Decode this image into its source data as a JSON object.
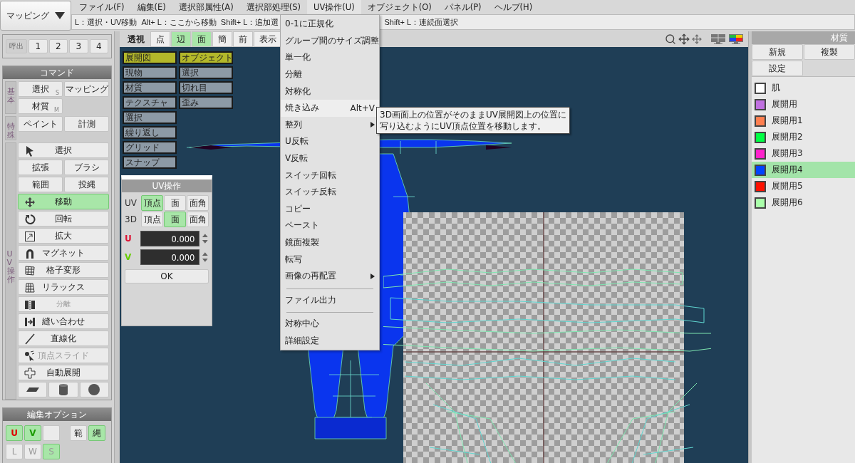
{
  "mode_selector": {
    "label": "マッピング"
  },
  "menu_bar": [
    {
      "label": "ファイル(F)",
      "selected": false
    },
    {
      "label": "編集(E)",
      "selected": false
    },
    {
      "label": "選択部属性(A)",
      "selected": false
    },
    {
      "label": "選択部処理(S)",
      "selected": false
    },
    {
      "label": "UV操作(U)",
      "selected": true
    },
    {
      "label": "オブジェクト(O)",
      "selected": false
    },
    {
      "label": "パネル(P)",
      "selected": false
    },
    {
      "label": "ヘルプ(H)",
      "selected": false
    }
  ],
  "status_hints": {
    "left": [
      "L：選択・UV移動",
      "Alt+ L：ここから移動",
      "Shift+ L：追加選"
    ],
    "right": [
      "Shift+ L：連続面選択"
    ]
  },
  "presets": {
    "label": "呼出",
    "slots": [
      "1",
      "2",
      "3",
      "4"
    ]
  },
  "command_panel": {
    "title": "コマンド",
    "groups": [
      {
        "label": "基本",
        "buttons": [
          {
            "label": "選択",
            "key": "S",
            "selected": false
          },
          {
            "label": "マッピング",
            "selected": false
          },
          {
            "label": "材質",
            "key": "M",
            "selected": false
          }
        ]
      },
      {
        "label": "特殊",
        "buttons": [
          {
            "label": "ペイント",
            "selected": false
          },
          {
            "label": "計測",
            "selected": false
          }
        ]
      }
    ],
    "uv_group": {
      "label": "UV操作",
      "rows": [
        [
          {
            "label": "選択",
            "kind": "pointer",
            "selected": false,
            "disabled": false
          }
        ],
        [
          {
            "label": "拡張",
            "kind": "text",
            "selected": false,
            "disabled": false
          },
          {
            "label": "ブラシ",
            "kind": "text",
            "selected": false,
            "disabled": false
          }
        ],
        [
          {
            "label": "範囲",
            "kind": "text",
            "selected": false,
            "disabled": false
          },
          {
            "label": "投縄",
            "kind": "text",
            "selected": false,
            "disabled": false
          }
        ],
        [
          {
            "label": "移動",
            "kind": "move",
            "selected": true,
            "disabled": false
          }
        ],
        [
          {
            "label": "回転",
            "kind": "rotate",
            "selected": false,
            "disabled": false
          }
        ],
        [
          {
            "label": "拡大",
            "kind": "scale",
            "selected": false,
            "disabled": false
          }
        ],
        [
          {
            "label": "マグネット",
            "kind": "magnet",
            "selected": false,
            "disabled": false
          }
        ],
        [
          {
            "label": "格子変形",
            "kind": "lattice",
            "selected": false,
            "disabled": false
          }
        ],
        [
          {
            "label": "リラックス",
            "kind": "relax",
            "selected": false,
            "disabled": false
          }
        ],
        [
          {
            "label": "分離",
            "kind": "split",
            "selected": false,
            "disabled": true
          }
        ],
        [
          {
            "label": "縫い合わせ",
            "kind": "stitch",
            "selected": false,
            "disabled": false
          }
        ],
        [
          {
            "label": "直線化",
            "kind": "line",
            "selected": false,
            "disabled": false
          }
        ],
        [
          {
            "label": "頂点スライド",
            "kind": "slide",
            "selected": false,
            "disabled": true
          }
        ],
        [
          {
            "label": "自動展開",
            "kind": "unfold",
            "selected": false,
            "disabled": false
          }
        ],
        [
          {
            "kind": "plane",
            "selected": false
          },
          {
            "kind": "cylinder",
            "selected": false
          },
          {
            "kind": "sphere",
            "selected": false
          }
        ]
      ]
    }
  },
  "edit_options": {
    "title": "編集オプション",
    "rows": [
      [
        {
          "label": "U",
          "color": "#e00000",
          "on": true
        },
        {
          "label": "V",
          "color": "#1a9a00",
          "on": true
        },
        {
          "kind": "blank",
          "on": false
        },
        {
          "kind": "gap"
        },
        {
          "label": "範",
          "on": false
        },
        {
          "label": "縄",
          "on": true
        }
      ],
      [
        {
          "label": "L",
          "on": false,
          "disabled": true
        },
        {
          "label": "W",
          "on": false,
          "disabled": true
        },
        {
          "label": "S",
          "on": true,
          "disabled": true
        }
      ]
    ]
  },
  "view_toolbar": [
    {
      "label": "透視",
      "kind": "label"
    },
    {
      "label": "点",
      "selected": false
    },
    {
      "label": "辺",
      "selected": true
    },
    {
      "label": "面",
      "selected": true
    },
    {
      "label": "簡",
      "selected": false
    },
    {
      "label": "前",
      "selected": false
    },
    {
      "label": "表示",
      "selected": false
    }
  ],
  "display_toggles": {
    "left": [
      {
        "label": "展開図",
        "on": true
      },
      {
        "label": "現物",
        "on": false
      },
      {
        "label": "材質",
        "on": false
      },
      {
        "label": "テクスチャ",
        "on": false
      },
      {
        "label": "選択",
        "on": false
      },
      {
        "label": "繰り返し",
        "on": false
      },
      {
        "label": "グリッド",
        "on": false
      },
      {
        "label": "スナップ",
        "on": false
      }
    ],
    "right": [
      {
        "label": "オブジェクト",
        "on": true
      },
      {
        "label": "選択",
        "on": false
      },
      {
        "label": "切れ目",
        "on": false
      },
      {
        "label": "歪み",
        "on": false
      }
    ]
  },
  "uv_dialog": {
    "title": "UV操作",
    "rows": [
      {
        "label": "UV",
        "options": [
          {
            "label": "頂点",
            "selected": true
          },
          {
            "label": "面",
            "selected": false
          },
          {
            "label": "面角",
            "selected": false
          }
        ]
      },
      {
        "label": "3D",
        "options": [
          {
            "label": "頂点",
            "selected": false
          },
          {
            "label": "面",
            "selected": true
          },
          {
            "label": "面角",
            "selected": false
          }
        ]
      }
    ],
    "fields": [
      {
        "label": "U",
        "color": "#dd1133",
        "value": "0.000"
      },
      {
        "label": "V",
        "color": "#66cc00",
        "value": "0.000"
      }
    ],
    "ok": "OK"
  },
  "uv_menu": [
    {
      "kind": "item",
      "label": "0-1に正規化",
      "selected": false,
      "submenu": false
    },
    {
      "kind": "item",
      "label": "グループ間のサイズ調整",
      "selected": false,
      "submenu": false
    },
    {
      "kind": "item",
      "label": "単一化",
      "selected": false,
      "submenu": false
    },
    {
      "kind": "item",
      "label": "分離",
      "selected": false,
      "submenu": false
    },
    {
      "kind": "item",
      "label": "対称化",
      "selected": false,
      "submenu": false
    },
    {
      "kind": "item",
      "label": "焼き込み",
      "shortcut": "Alt+V",
      "selected": true,
      "submenu": false
    },
    {
      "kind": "item",
      "label": "整列",
      "selected": false,
      "submenu": true
    },
    {
      "kind": "item",
      "label": "U反転",
      "selected": false,
      "submenu": false
    },
    {
      "kind": "item",
      "label": "V反転",
      "selected": false,
      "submenu": false
    },
    {
      "kind": "item",
      "label": "スイッチ回転",
      "selected": false,
      "submenu": false
    },
    {
      "kind": "item",
      "label": "スイッチ反転",
      "selected": false,
      "submenu": false
    },
    {
      "kind": "item",
      "label": "コピー",
      "selected": false,
      "submenu": false
    },
    {
      "kind": "item",
      "label": "ペースト",
      "selected": false,
      "submenu": false
    },
    {
      "kind": "item",
      "label": "鏡面複製",
      "selected": false,
      "submenu": false
    },
    {
      "kind": "item",
      "label": "転写",
      "selected": false,
      "submenu": false
    },
    {
      "kind": "item",
      "label": "画像の再配置",
      "selected": false,
      "submenu": true
    },
    {
      "kind": "separator"
    },
    {
      "kind": "item",
      "label": "ファイル出力",
      "selected": false,
      "submenu": false
    },
    {
      "kind": "separator"
    },
    {
      "kind": "item",
      "label": "対称中心",
      "selected": false,
      "submenu": false
    },
    {
      "kind": "item",
      "label": "詳細設定",
      "selected": false,
      "submenu": false
    }
  ],
  "tooltip": {
    "lines": [
      "3D画面上の位置がそのままUV展開図上の位置に",
      "写り込むようにUV頂点位置を移動します。"
    ]
  },
  "materials": {
    "title": "材質",
    "buttons": [
      "新規",
      "複製",
      "設定"
    ],
    "items": [
      {
        "name": "肌",
        "color": "#ffffff",
        "selected": false
      },
      {
        "name": "展開用",
        "color": "#c070e0",
        "selected": false
      },
      {
        "name": "展開用1",
        "color": "#ff7f50",
        "selected": false
      },
      {
        "name": "展開用2",
        "color": "#00ff44",
        "selected": false
      },
      {
        "name": "展開用3",
        "color": "#ff22cc",
        "selected": false
      },
      {
        "name": "展開用4",
        "color": "#0044ff",
        "selected": true
      },
      {
        "name": "展開用5",
        "color": "#ff1100",
        "selected": false
      },
      {
        "name": "展開用6",
        "color": "#aaffaa",
        "selected": false
      }
    ]
  }
}
